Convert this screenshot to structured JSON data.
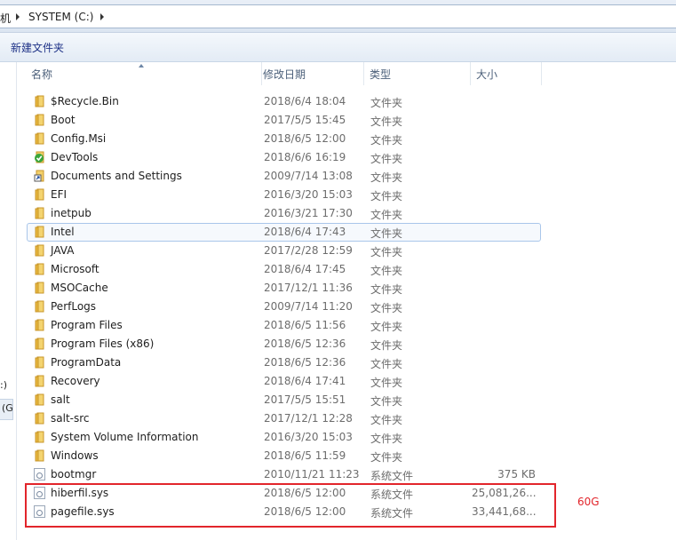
{
  "address": {
    "crumbs": [
      "机",
      "SYSTEM (C:)"
    ]
  },
  "toolbar": {
    "new_folder": "新建文件夹"
  },
  "nav": {
    "fragment_1": ":)",
    "fragment_2": "(G"
  },
  "columns": {
    "name": "名称",
    "date": "修改日期",
    "type": "类型",
    "size": "大小"
  },
  "rows": [
    {
      "name": "$Recycle.Bin",
      "date": "2018/6/4 18:04",
      "type": "文件夹",
      "size": "",
      "icon": "folder-icon"
    },
    {
      "name": "Boot",
      "date": "2017/5/5 15:45",
      "type": "文件夹",
      "size": "",
      "icon": "folder-icon"
    },
    {
      "name": "Config.Msi",
      "date": "2018/6/5 12:00",
      "type": "文件夹",
      "size": "",
      "icon": "folder-icon"
    },
    {
      "name": "DevTools",
      "date": "2018/6/6 16:19",
      "type": "文件夹",
      "size": "",
      "icon": "green-check-icon"
    },
    {
      "name": "Documents and Settings",
      "date": "2009/7/14 13:08",
      "type": "文件夹",
      "size": "",
      "icon": "shortcut-icon"
    },
    {
      "name": "EFI",
      "date": "2016/3/20 15:03",
      "type": "文件夹",
      "size": "",
      "icon": "folder-icon"
    },
    {
      "name": "inetpub",
      "date": "2016/3/21 17:30",
      "type": "文件夹",
      "size": "",
      "icon": "folder-icon"
    },
    {
      "name": "Intel",
      "date": "2018/6/4 17:43",
      "type": "文件夹",
      "size": "",
      "icon": "folder-icon"
    },
    {
      "name": "JAVA",
      "date": "2017/2/28 12:59",
      "type": "文件夹",
      "size": "",
      "icon": "folder-icon"
    },
    {
      "name": "Microsoft",
      "date": "2018/6/4 17:45",
      "type": "文件夹",
      "size": "",
      "icon": "folder-icon"
    },
    {
      "name": "MSOCache",
      "date": "2017/12/1 11:36",
      "type": "文件夹",
      "size": "",
      "icon": "folder-icon"
    },
    {
      "name": "PerfLogs",
      "date": "2009/7/14 11:20",
      "type": "文件夹",
      "size": "",
      "icon": "folder-icon"
    },
    {
      "name": "Program Files",
      "date": "2018/6/5 11:56",
      "type": "文件夹",
      "size": "",
      "icon": "folder-icon"
    },
    {
      "name": "Program Files (x86)",
      "date": "2018/6/5 12:36",
      "type": "文件夹",
      "size": "",
      "icon": "folder-icon"
    },
    {
      "name": "ProgramData",
      "date": "2018/6/5 12:36",
      "type": "文件夹",
      "size": "",
      "icon": "folder-icon"
    },
    {
      "name": "Recovery",
      "date": "2018/6/4 17:41",
      "type": "文件夹",
      "size": "",
      "icon": "folder-icon"
    },
    {
      "name": "salt",
      "date": "2017/5/5 15:51",
      "type": "文件夹",
      "size": "",
      "icon": "folder-icon"
    },
    {
      "name": "salt-src",
      "date": "2017/12/1 12:28",
      "type": "文件夹",
      "size": "",
      "icon": "folder-icon"
    },
    {
      "name": "System Volume Information",
      "date": "2016/3/20 15:03",
      "type": "文件夹",
      "size": "",
      "icon": "folder-icon"
    },
    {
      "name": "Windows",
      "date": "2018/6/5 11:59",
      "type": "文件夹",
      "size": "",
      "icon": "folder-icon"
    },
    {
      "name": "bootmgr",
      "date": "2010/11/21 11:23",
      "type": "系统文件",
      "size": "375 KB",
      "icon": "system-file-icon"
    },
    {
      "name": "hiberfil.sys",
      "date": "2018/6/5 12:00",
      "type": "系统文件",
      "size": "25,081,26...",
      "icon": "system-file-icon"
    },
    {
      "name": "pagefile.sys",
      "date": "2018/6/5 12:00",
      "type": "系统文件",
      "size": "33,441,68...",
      "icon": "system-file-icon"
    }
  ],
  "highlighted_row": "Intel",
  "annotation": {
    "label": "60G",
    "color": "#e2252b"
  },
  "colors": {
    "toolbar_text": "#1e3287",
    "header_text": "#4c607a",
    "meta_text": "#6d6d6d",
    "folder": "#e7b73d"
  }
}
